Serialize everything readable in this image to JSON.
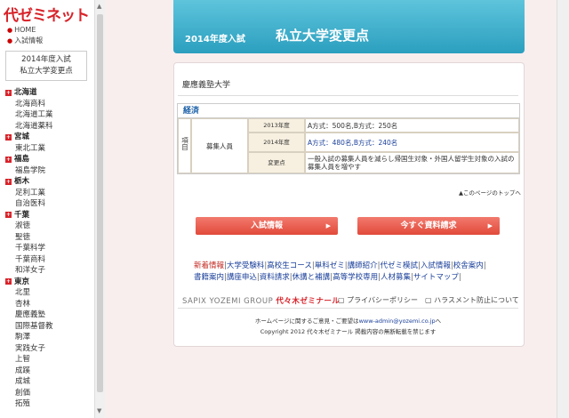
{
  "sidebar": {
    "logo": "代ゼミネット",
    "home": "HOME",
    "exam_info": "入試情報",
    "box_line1": "2014年度入試",
    "box_line2": "私立大学変更点",
    "groups": [
      {
        "pref": "北海道",
        "unis": [
          "北海商科",
          "北海道工業",
          "北海道薬科"
        ]
      },
      {
        "pref": "宮城",
        "unis": [
          "東北工業"
        ]
      },
      {
        "pref": "福島",
        "unis": [
          "福島学院"
        ]
      },
      {
        "pref": "栃木",
        "unis": [
          "足利工業",
          "自治医科"
        ]
      },
      {
        "pref": "千葉",
        "unis": [
          "淑徳",
          "聖徳",
          "千葉科学",
          "千葉商科",
          "和洋女子"
        ]
      },
      {
        "pref": "東京",
        "unis": [
          "北里",
          "杏林",
          "慶應義塾",
          "国際基督教",
          "駒澤",
          "実践女子",
          "上智",
          "成蹊",
          "成城",
          "創価",
          "拓殖"
        ]
      }
    ]
  },
  "banner": {
    "year": "2014年度入試",
    "title": "私立大学変更点"
  },
  "main": {
    "university": "慶應義塾大学",
    "faculty": "経済",
    "row_label": "項目",
    "item": "募集人員",
    "rows": [
      {
        "label": "2013年度",
        "value": "A方式：500名,B方式：250名"
      },
      {
        "label": "2014年度",
        "value": "A方式：480名,B方式：240名"
      },
      {
        "label": "変更点",
        "value": "一般入試の募集人員を減らし帰国生対象・外国人留学生対象の入試の募集人員を増やす"
      }
    ],
    "page_top": "▲このページのトップへ",
    "btn_exam": "入試情報",
    "btn_request": "今すぐ資料請求",
    "links_line1": [
      "新着情報",
      "大学受験科",
      "高校生コース",
      "単科ゼミ",
      "講師紹介",
      "代ゼミ模試",
      "入試情報",
      "校舎案内"
    ],
    "links_line2": [
      "書籍案内",
      "講座申込",
      "資料請求",
      "休講と補講",
      "高等学校専用",
      "人材募集",
      "サイトマップ"
    ],
    "footer_group": "SAPIX YOZEMI GROUP",
    "footer_brand": "代々木ゼミナール",
    "privacy": "プライバシーポリシー",
    "harassment": "ハラスメント防止について",
    "contact_pre": "ホームページに関するご意見・ご要望は",
    "contact_mail": "www-admin@yozemi.co.jp",
    "contact_post": "へ",
    "copyright": "Copyright 2012 代々木ゼミナール 掲載内容の無断転載を禁じます"
  }
}
